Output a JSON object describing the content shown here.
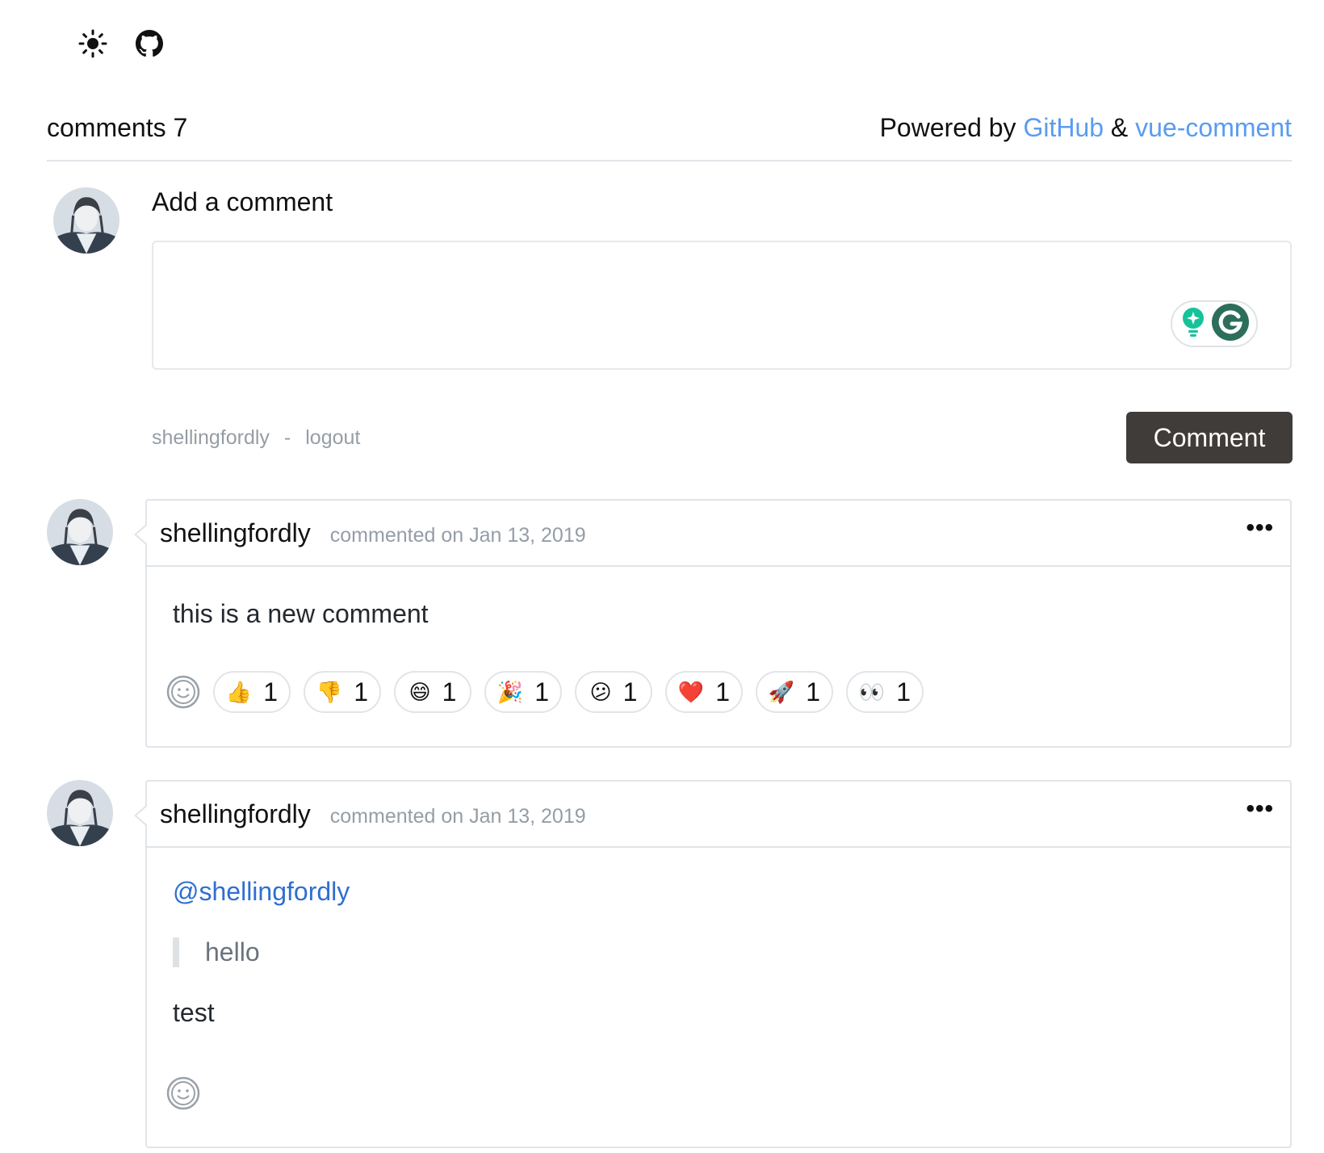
{
  "top_icons": [
    "sun-icon",
    "github-icon"
  ],
  "header": {
    "count_label": "comments 7",
    "powered_prefix": "Powered by",
    "github_link": "GitHub",
    "ampersand": "&",
    "vue_comment_link": "vue-comment"
  },
  "composer": {
    "title": "Add a comment",
    "textarea_value": "",
    "username": "shellingfordly",
    "separator": "-",
    "logout": "logout",
    "submit_label": "Comment"
  },
  "comments": [
    {
      "author": "shellingfordly",
      "date": "commented on Jan 13, 2019",
      "more": "•••",
      "body": "this is a new comment",
      "reactions": [
        {
          "emoji": "👍",
          "icon": "thumbs-up",
          "count": "1"
        },
        {
          "emoji": "👎",
          "icon": "thumbs-down",
          "count": "1"
        },
        {
          "emoji": "😄",
          "icon": "laugh",
          "count": "1"
        },
        {
          "emoji": "🎉",
          "icon": "hooray",
          "count": "1"
        },
        {
          "emoji": "😕",
          "icon": "confused",
          "count": "1"
        },
        {
          "emoji": "❤️",
          "icon": "heart",
          "count": "1"
        },
        {
          "emoji": "🚀",
          "icon": "rocket",
          "count": "1"
        },
        {
          "emoji": "👀",
          "icon": "eyes",
          "count": "1"
        }
      ]
    },
    {
      "author": "shellingfordly",
      "date": "commented on Jan 13, 2019",
      "more": "•••",
      "mention": "@shellingfordly",
      "quote": "hello",
      "body": "test",
      "reactions": []
    }
  ],
  "colors": {
    "link": "#5a9cf0",
    "mention": "#2f6fd0",
    "button_bg": "#403c39",
    "border": "#e1e4e8",
    "muted": "#959da5",
    "grammarly_green": "#15c39a"
  }
}
